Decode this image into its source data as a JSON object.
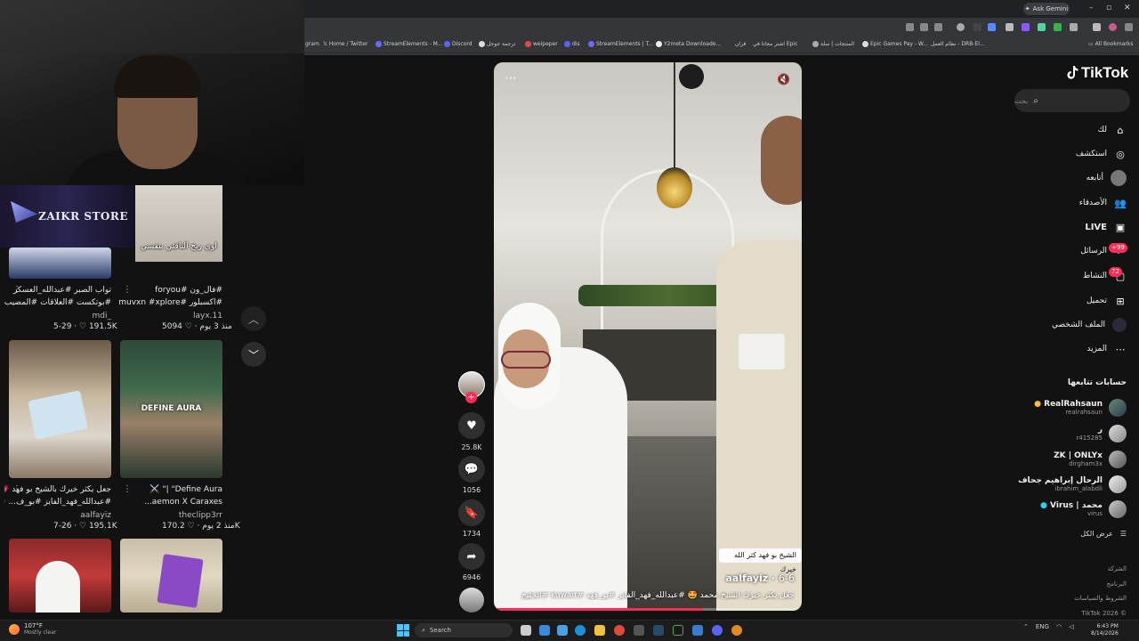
{
  "overlay": {
    "brand": "ZAIKR STORE",
    "thumb_caption": "اوي ربح الناقتي بنفسي"
  },
  "browser": {
    "gemini_label": "Ask Gemini",
    "bookmarks": [
      "gram",
      "Home / Twitter",
      "StreamElements - M...",
      "Discord",
      "ترجمة جوجل",
      "weipeper",
      "dis",
      "StreamElements | T...",
      "Y2meta Downloade...",
      "قران",
      "اشتر مجانا في Epic",
      "المنتجات | سلة",
      "Epic Games Pay - W...",
      "نظام العمل - DRB-El...",
      "All Bookmarks"
    ]
  },
  "grid": [
    {
      "caption1": "#فال_ون #foryou",
      "caption2": "#اكسبلور #muvxn #xplore",
      "author": "layx.11",
      "likes": "5094",
      "age": "منذ 3 يوم"
    },
    {
      "caption1": "تواب الصبر #عبدالله_العسكر",
      "caption2": "#بوتكست #العلاقات #المصيب...",
      "author": "mdi_",
      "likes": "191.5K",
      "age": "5-29"
    },
    {
      "caption1": "Define Aura\" |\" ⚔️",
      "caption2": "aemon X Caraxes...",
      "author": "theclipp3rr",
      "likes": "170.2K",
      "age": "منذ 2 يوم",
      "thumb_text": "DEFINE AURA"
    },
    {
      "caption1": "جعل يكثر خيرك بالشيخ بو فهد 💗",
      "caption2": "#عبدالله_فهد_الفايز #بو_ف... 🤩",
      "author": "aalfayiz",
      "likes": "195.1K",
      "age": "7-26"
    }
  ],
  "video": {
    "sticker": "الشيخ بو فهد كثر الله خيرك",
    "author": "aalfayiz",
    "date": "6-6",
    "description": "جعل يكثر خيرك الشيخ محمد 🤩 #عبدالله_فهد_الفايز #بو_فهد #kuwait #الخليج",
    "progress": 0.68
  },
  "actions": {
    "likes": "25.8K",
    "comments": "1056",
    "saves": "1734",
    "shares": "6946"
  },
  "sidebar": {
    "logo": "TikTok",
    "search_placeholder": "بحث",
    "nav": [
      {
        "label": "لك",
        "icon": "home-icon"
      },
      {
        "label": "استكشف",
        "icon": "compass-icon"
      },
      {
        "label": "أتابعه",
        "icon": "following-avatar"
      },
      {
        "label": "الأصدقاء",
        "icon": "friends-icon"
      },
      {
        "label": "LIVE",
        "icon": "live-icon"
      },
      {
        "label": "الرسائل",
        "icon": "messages-icon",
        "badge": "+99"
      },
      {
        "label": "النشاط",
        "icon": "activity-icon",
        "badge": "72"
      },
      {
        "label": "تحميل",
        "icon": "upload-icon"
      },
      {
        "label": "الملف الشخصي",
        "icon": "profile-icon"
      },
      {
        "label": "المزيد",
        "icon": "more-icon"
      }
    ],
    "following_title": "حسابات تتابعها",
    "following": [
      {
        "name": "RealRahsaun",
        "handle": "realrahsaun"
      },
      {
        "name": "ر",
        "handle": "r415285"
      },
      {
        "name": "ZK | ONLYx",
        "handle": "dirgham3x"
      },
      {
        "name": "الرحال إبراهيم جحاف",
        "handle": "ibrahim_alabdli"
      },
      {
        "name": "Virus | محمد",
        "handle": "virus"
      }
    ],
    "see_all": "عرض الكل",
    "footer": [
      "الشركة",
      "البرنامج",
      "الشروط والسياسات",
      "TikTok 2026 ©"
    ]
  },
  "taskbar": {
    "weather_temp": "107°F",
    "weather_desc": "Mostly clear",
    "search": "Search",
    "lang": "ENG",
    "time": "6:43 PM",
    "date": "8/14/2026"
  }
}
